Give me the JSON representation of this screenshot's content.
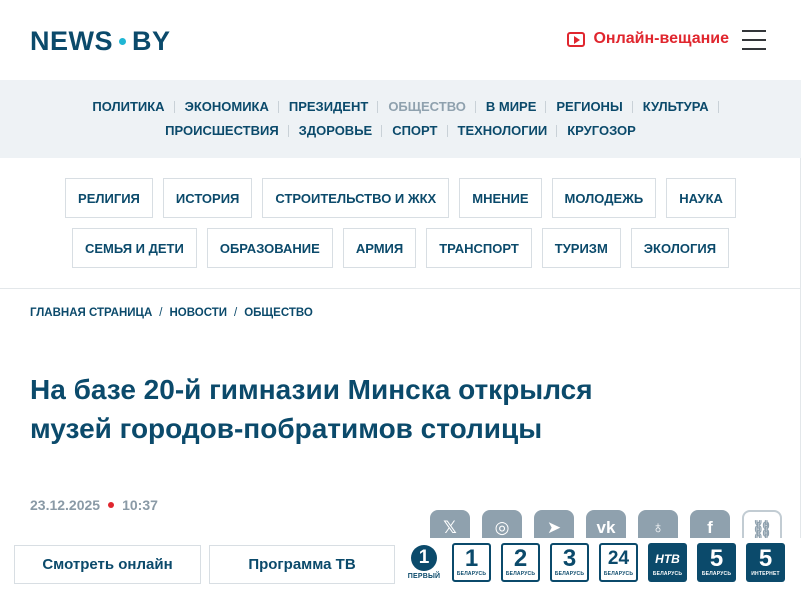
{
  "header": {
    "logo_left": "NEWS",
    "logo_right": "BY",
    "live_label": "Онлайн-вещание"
  },
  "nav": {
    "row1": [
      {
        "label": "ПОЛИТИКА"
      },
      {
        "label": "ЭКОНОМИКА"
      },
      {
        "label": "ПРЕЗИДЕНТ"
      },
      {
        "label": "ОБЩЕСТВО",
        "active": true
      },
      {
        "label": "В МИРЕ"
      },
      {
        "label": "РЕГИОНЫ"
      },
      {
        "label": "КУЛЬТУРА"
      }
    ],
    "row2": [
      {
        "label": "ПРОИСШЕСТВИЯ"
      },
      {
        "label": "ЗДОРОВЬЕ"
      },
      {
        "label": "СПОРТ"
      },
      {
        "label": "ТЕХНОЛОГИИ"
      },
      {
        "label": "КРУГОЗОР"
      }
    ]
  },
  "subnav": {
    "row1": [
      "РЕЛИГИЯ",
      "ИСТОРИЯ",
      "СТРОИТЕЛЬСТВО И ЖКХ",
      "МНЕНИЕ",
      "МОЛОДЕЖЬ",
      "НАУКА"
    ],
    "row2": [
      "СЕМЬЯ И ДЕТИ",
      "ОБРАЗОВАНИЕ",
      "АРМИЯ",
      "ТРАНСПОРТ",
      "ТУРИЗМ",
      "ЭКОЛОГИЯ"
    ]
  },
  "breadcrumb": [
    "ГЛАВНАЯ СТРАНИЦА",
    "НОВОСТИ",
    "ОБЩЕСТВО"
  ],
  "article": {
    "title_line1": "На базе 20-й гимназии Минска открылся",
    "title_line2": "музей городов-побратимов столицы",
    "date": "23.12.2025",
    "time": "10:37"
  },
  "shares": [
    "x-icon",
    "ok-icon",
    "telegram-icon",
    "vk-icon",
    "odnoklassniki-icon",
    "facebook-icon",
    "link-icon"
  ],
  "bottombar": {
    "watch_label": "Смотреть онлайн",
    "program_label": "Программа ТВ",
    "channels": [
      {
        "num": "1",
        "label": "ПЕРВЫЙ"
      },
      {
        "num": "1",
        "label": "БЕЛАРУСЬ"
      },
      {
        "num": "2",
        "label": "БЕЛАРУСЬ"
      },
      {
        "num": "3",
        "label": "БЕЛАРУСЬ"
      },
      {
        "num": "24",
        "label": "БЕЛАРУСЬ"
      },
      {
        "num": "НТВ",
        "label": "БЕЛАРУСЬ"
      },
      {
        "num": "5",
        "label": "БЕЛАРУСЬ"
      },
      {
        "num": "5",
        "label": "ИНТЕРНЕТ"
      }
    ]
  }
}
